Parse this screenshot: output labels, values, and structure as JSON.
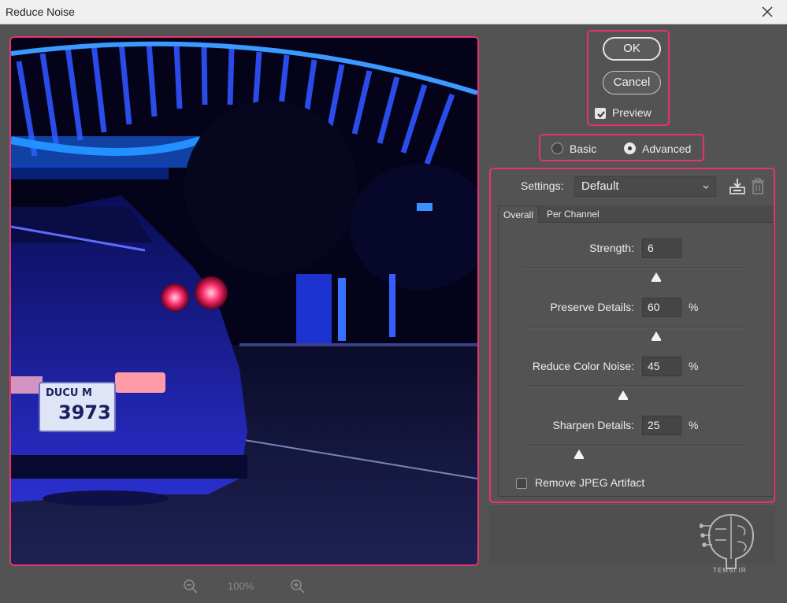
{
  "window": {
    "title": "Reduce Noise"
  },
  "preview": {
    "plate_top": "DUCU M",
    "plate_number": "3973"
  },
  "zoom": {
    "level": "100%"
  },
  "buttons": {
    "ok_label": "OK",
    "cancel_label": "Cancel"
  },
  "preview_toggle": {
    "label": "Preview",
    "checked": true
  },
  "mode": {
    "options": [
      {
        "label": "Basic",
        "selected": false
      },
      {
        "label": "Advanced",
        "selected": true
      }
    ]
  },
  "settings": {
    "label": "Settings:",
    "preset": "Default",
    "tabs": [
      {
        "label": "Overall",
        "active": true
      },
      {
        "label": "Per Channel",
        "active": false
      }
    ],
    "sliders": [
      {
        "label": "Strength:",
        "value": "6",
        "unit": "",
        "fraction": 0.6
      },
      {
        "label": "Preserve Details:",
        "value": "60",
        "unit": "%",
        "fraction": 0.6
      },
      {
        "label": "Reduce Color Noise:",
        "value": "45",
        "unit": "%",
        "fraction": 0.45
      },
      {
        "label": "Sharpen Details:",
        "value": "25",
        "unit": "%",
        "fraction": 0.25
      }
    ],
    "jpeg_artifact": {
      "label": "Remove JPEG Artifact",
      "checked": false
    }
  },
  "watermark": {
    "text": "TEMSI.IR"
  },
  "colors": {
    "highlight": "#e8326e",
    "dialog_bg": "#535353",
    "titlebar": "#f0f0f0"
  }
}
